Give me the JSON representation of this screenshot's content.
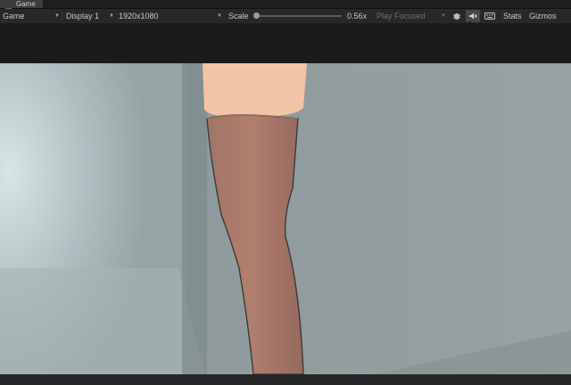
{
  "window": {
    "tab_label": "Game",
    "tab_icon": "gamepad-icon"
  },
  "toolbar": {
    "view_mode": "Game",
    "display": "Display 1",
    "resolution": "1920x1080",
    "scale_label": "Scale",
    "scale_value": "0.56x",
    "play_mode": "Play Focused",
    "stats_label": "Stats",
    "gizmos_label": "Gizmos",
    "icons": [
      "bug-icon",
      "audio-mute-icon",
      "keyboard-icon"
    ]
  },
  "scene": {
    "background": "#919d9f",
    "light_patch": "#c9d8d9",
    "leg_skin": "#f2c1a1",
    "stocking": "#9c7065",
    "outline": "#3a3b3b"
  }
}
